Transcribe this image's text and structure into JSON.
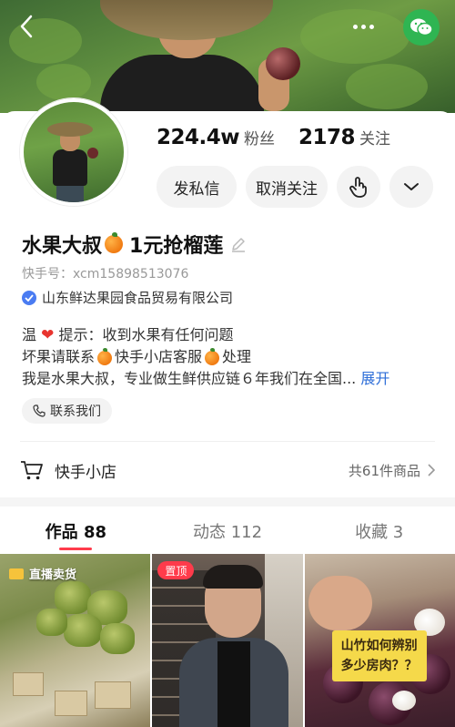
{
  "nav": {
    "back_icon": "chevron-left-icon",
    "more_icon": "more-dots-icon",
    "wechat_icon": "wechat-icon",
    "wechat_color": "#2fb552"
  },
  "profile": {
    "followers_count": "224.4w",
    "followers_label": "粉丝",
    "following_count": "2178",
    "following_label": "关注",
    "name_part1": "水果大叔",
    "name_part2": "1元抢榴莲",
    "uid": "快手号：xcm15898513076",
    "company": "山东鲜达果园食品贸易有限公司"
  },
  "actions": {
    "message": "发私信",
    "unfollow": "取消关注",
    "tap_icon": "hand-tap-icon",
    "dropdown_icon": "chevron-down-icon"
  },
  "bio": {
    "line1_a": "温",
    "line1_b": "提示：收到水果有任何问题",
    "line2_a": "坏果请联系",
    "line2_b": "快手小店客服",
    "line2_c": "处理",
    "line3": "我是水果大叔，专业做生鲜供应链６年我们在全国...",
    "expand": "展开"
  },
  "contact": {
    "label": "联系我们"
  },
  "shop": {
    "title": "快手小店",
    "count": "共61件商品"
  },
  "tabs": [
    {
      "label": "作品 88"
    },
    {
      "label": "动态 112"
    },
    {
      "label": "收藏 3"
    }
  ],
  "posts": {
    "live_tag": "直播卖货",
    "pin_tag": "置顶",
    "question_line1": "山竹如何辨别",
    "question_line2": "多少房肉？？"
  },
  "colors": {
    "accent": "#ff3b4b",
    "link": "#2f6fd8",
    "verify": "#4a7cf2"
  }
}
